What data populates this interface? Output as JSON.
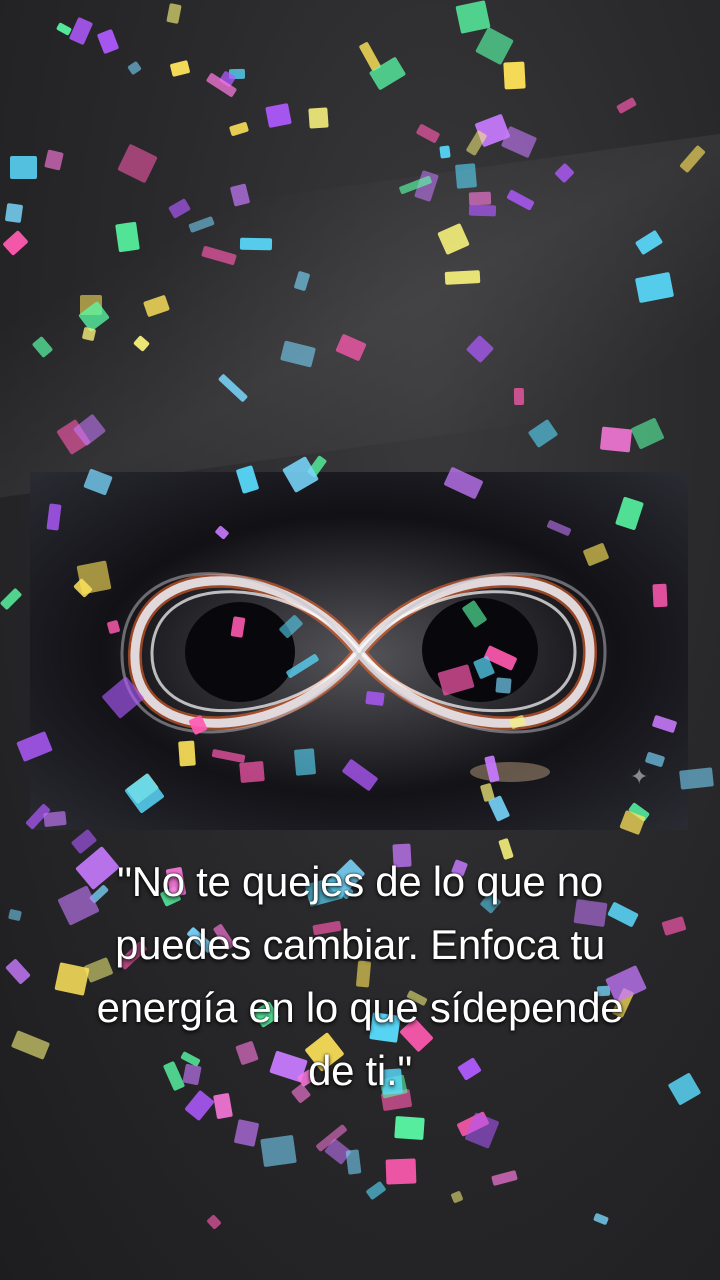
{
  "quote": {
    "lines": [
      "\"No te quejes de lo que no",
      "puedes cambiar. Enfoca tu",
      "energía en lo que sídepende",
      "de ti.\""
    ]
  },
  "image": {
    "subject_icon": "infinity-icon",
    "colors": {
      "swirl": "#d8d8dc",
      "ember": "#ff6a2a",
      "space": "#111116"
    }
  },
  "confetti_colors": [
    "#ff5ab0",
    "#b05aff",
    "#5adcff",
    "#ffe45a",
    "#5affa8",
    "#ff7ae0",
    "#c87aff",
    "#7ad8ff",
    "#f5f07a"
  ]
}
